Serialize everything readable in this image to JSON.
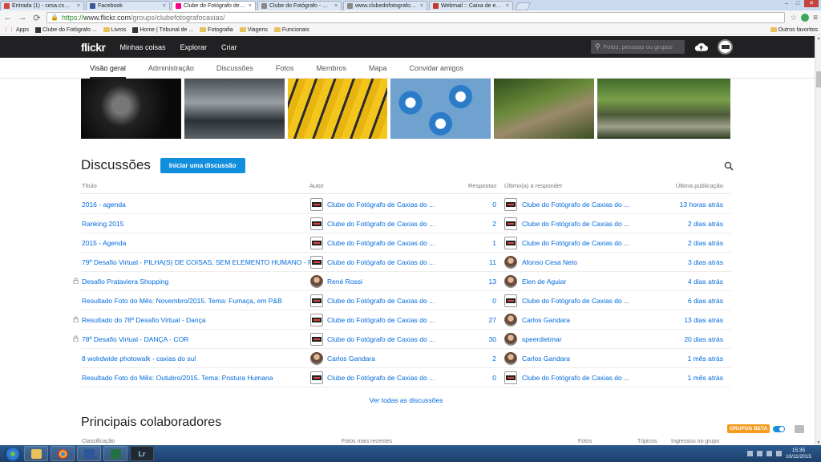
{
  "browser": {
    "tabs": [
      {
        "label": "Entrada (1) - cesa.cs@gm...",
        "color": "#d44638",
        "active": false
      },
      {
        "label": "Facebook",
        "color": "#3b5998",
        "active": false
      },
      {
        "label": "Clube do Fotógrafo de Ca...",
        "color": "#ff0084",
        "active": true
      },
      {
        "label": "Clube do Fotógrafo - Nos...",
        "color": "#888888",
        "active": false
      },
      {
        "label": "www.clubedofotografodec...",
        "color": "#888888",
        "active": false
      },
      {
        "label": "Webmail :: Caixa de entra...",
        "color": "#c0392b",
        "active": false
      }
    ],
    "url_scheme": "https://",
    "url_host": "www.flickr.com",
    "url_path": "/groups/clubefotografocaxias/",
    "bookmarks": [
      {
        "label": "Apps",
        "type": "apps"
      },
      {
        "label": "Clube do Fotógrafo ...",
        "type": "site"
      },
      {
        "label": "Livros",
        "type": "folder"
      },
      {
        "label": "Home | Tribunal de ...",
        "type": "site"
      },
      {
        "label": "Fotografia",
        "type": "folder"
      },
      {
        "label": "Viagens",
        "type": "folder"
      },
      {
        "label": "Funcionais",
        "type": "folder"
      }
    ],
    "other_bookmarks": "Outros favoritos"
  },
  "flickr_nav": {
    "logo": "flickr",
    "links": [
      "Minhas coisas",
      "Explorar",
      "Criar"
    ],
    "search_placeholder": "Fotos, pessoas ou grupos"
  },
  "subnav": [
    {
      "label": "Visão geral",
      "active": true
    },
    {
      "label": "Administração",
      "active": false
    },
    {
      "label": "Discussões",
      "active": false
    },
    {
      "label": "Fotos",
      "active": false
    },
    {
      "label": "Membros",
      "active": false
    },
    {
      "label": "Mapa",
      "active": false
    },
    {
      "label": "Convidar amigos",
      "active": false
    }
  ],
  "discussions": {
    "title": "Discussões",
    "start_button": "Iniciar uma discussão",
    "columns": {
      "title": "Título",
      "author": "Autor",
      "replies": "Respostas",
      "last_reply": "Último(a) a responder",
      "last_post": "Última publicação"
    },
    "rows": [
      {
        "title": "2016 - agenda",
        "locked": false,
        "author": "Clube do Fotógrafo de Caxias do ...",
        "author_avatar": "group",
        "replies": "0",
        "last": "Clube do Fotógrafo de Caxias do ...",
        "last_avatar": "group",
        "date": "13 horas atrás"
      },
      {
        "title": "Ranking 2015",
        "locked": false,
        "author": "Clube do Fotógrafo de Caxias do ...",
        "author_avatar": "group",
        "replies": "2",
        "last": "Clube do Fotógrafo de Caxias do ...",
        "last_avatar": "group",
        "date": "2 dias atrás"
      },
      {
        "title": "2015 - Agenda",
        "locked": false,
        "author": "Clube do Fotógrafo de Caxias do ...",
        "author_avatar": "group",
        "replies": "1",
        "last": "Clube do Fotógrafo de Caxias do ...",
        "last_avatar": "group",
        "date": "2 dias atrás"
      },
      {
        "title": "79º Desafio Virtual - PILHA(S) DE COISAS, SEM ELEMENTO HUMANO - P...",
        "locked": false,
        "author": "Clube do Fotógrafo de Caxias do ...",
        "author_avatar": "group",
        "replies": "11",
        "last": "Afonso Cesa Neto",
        "last_avatar": "person",
        "date": "3 dias atrás"
      },
      {
        "title": "Desafio Prataviera Shopping",
        "locked": true,
        "author": "René Rossi",
        "author_avatar": "person",
        "replies": "13",
        "last": "Elen de Aguiar",
        "last_avatar": "person",
        "date": "4 dias atrás"
      },
      {
        "title": "Resultado Foto do Mês: Novembro/2015. Tema: Fumaça, em P&B",
        "locked": false,
        "author": "Clube do Fotógrafo de Caxias do ...",
        "author_avatar": "group",
        "replies": "0",
        "last": "Clube do Fotógrafo de Caxias do ...",
        "last_avatar": "group",
        "date": "6 dias atrás"
      },
      {
        "title": "Resultado do 78º Desafio Virtual - Dança",
        "locked": true,
        "author": "Clube do Fotógrafo de Caxias do ...",
        "author_avatar": "group",
        "replies": "27",
        "last": "Carlos Gandara",
        "last_avatar": "person",
        "date": "13 dias atrás"
      },
      {
        "title": "78º Desafio Virtual - DANÇA - COR",
        "locked": true,
        "author": "Clube do Fotógrafo de Caxias do ...",
        "author_avatar": "group",
        "replies": "30",
        "last": "speerdietmar",
        "last_avatar": "person",
        "date": "20 dias atrás"
      },
      {
        "title": "8 wolrdwide photowalk - caxias do sul",
        "locked": false,
        "author": "Carlos Gandara",
        "author_avatar": "person",
        "replies": "2",
        "last": "Carlos Gandara",
        "last_avatar": "person",
        "date": "1 mês atrás"
      },
      {
        "title": "Resultado Foto do Mês: Outubro/2015. Tema: Postura Humana",
        "locked": false,
        "author": "Clube do Fotógrafo de Caxias do ...",
        "author_avatar": "group",
        "replies": "0",
        "last": "Clube do Fotógrafo de Caxias do ...",
        "last_avatar": "group",
        "date": "1 mês atrás"
      }
    ],
    "view_all": "Ver todas as discussões"
  },
  "contributors": {
    "title": "Principais colaboradores",
    "columns": [
      "Classificação",
      "Fotos mais recentes",
      "Fotos",
      "Tópicos",
      "Ingressou no grupo"
    ]
  },
  "beta_badge": "GRUPOS BETA",
  "taskbar": {
    "apps": [
      "explorer",
      "chrome",
      "word",
      "excel",
      "Lr"
    ],
    "time": "15:35",
    "date": "10/11/2015"
  },
  "colors": {
    "accent_blue": "#128fdc",
    "link_blue": "#006add",
    "nav_dark": "#212124",
    "beta_orange": "#f39c1e"
  }
}
